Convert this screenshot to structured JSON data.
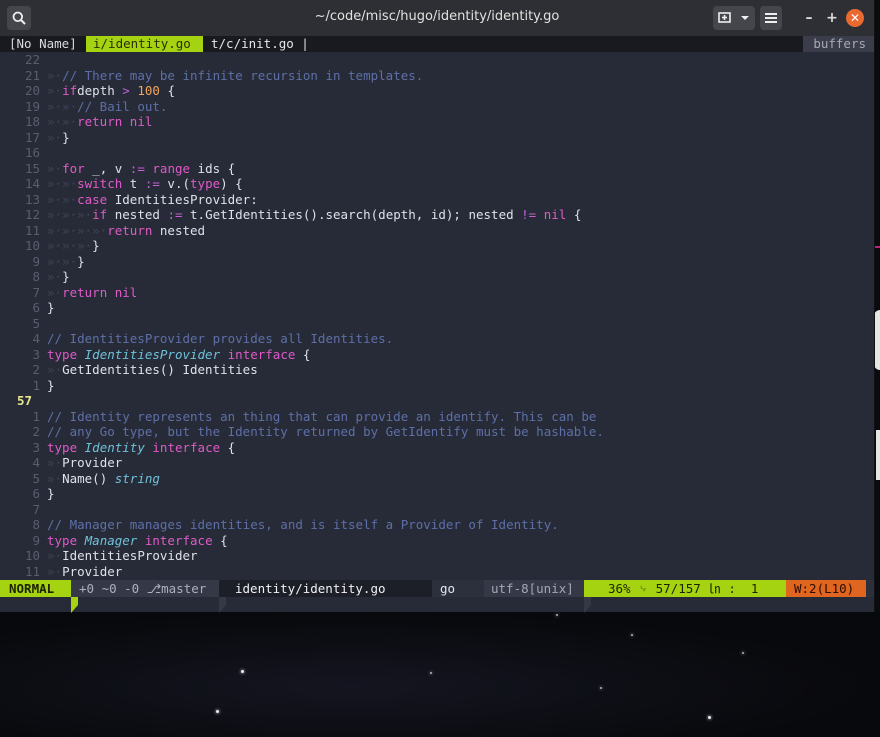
{
  "window": {
    "title": "~/code/misc/hugo/identity/identity.go"
  },
  "tabs": {
    "noname": "[No Name]",
    "active": "i/identity.go",
    "other": "t/c/init.go |",
    "buffers": "buffers"
  },
  "colors": {
    "accent": "#a5d312",
    "warning": "#e0651f",
    "close": "#e86a30",
    "background": "#272b38"
  },
  "icons": {
    "search": "search-icon",
    "newtab": "new-tab-icon",
    "dropdown": "chevron-down-icon",
    "menu": "hamburger-menu-icon",
    "minimize": "minimize-icon",
    "maximize": "maximize-icon",
    "close": "close-icon"
  },
  "editor": {
    "current_line": 57,
    "lines": [
      {
        "n": "22",
        "g": "",
        "segs": []
      },
      {
        "n": "21",
        "g": "»·",
        "segs": [
          [
            "cm",
            "// There may be infinite recursion in templates."
          ]
        ]
      },
      {
        "n": "20",
        "g": "»·",
        "segs": [
          [
            "kw",
            "if"
          ],
          [
            "",
            "depth "
          ],
          [
            "op",
            ">"
          ],
          [
            "",
            " "
          ],
          [
            "num",
            "100"
          ],
          [
            "",
            " {"
          ]
        ]
      },
      {
        "n": "19",
        "g": "»·»·",
        "segs": [
          [
            "cm",
            "// Bail out."
          ]
        ]
      },
      {
        "n": "18",
        "g": "»·»·",
        "segs": [
          [
            "kw",
            "return"
          ],
          [
            "",
            " "
          ],
          [
            "kw",
            "nil"
          ]
        ]
      },
      {
        "n": "17",
        "g": "»·",
        "segs": [
          [
            "",
            "}"
          ]
        ]
      },
      {
        "n": "16",
        "g": "",
        "segs": []
      },
      {
        "n": "15",
        "g": "»·",
        "segs": [
          [
            "kw",
            "for"
          ],
          [
            "",
            " _, v "
          ],
          [
            "op",
            ":="
          ],
          [
            "",
            " "
          ],
          [
            "kw",
            "range"
          ],
          [
            "",
            " ids {"
          ]
        ]
      },
      {
        "n": "14",
        "g": "»·»·",
        "segs": [
          [
            "kw",
            "switch"
          ],
          [
            "",
            " t "
          ],
          [
            "op",
            ":="
          ],
          [
            "",
            " v.("
          ],
          [
            "kw",
            "type"
          ],
          [
            "",
            ") {"
          ]
        ]
      },
      {
        "n": "13",
        "g": "»·»·",
        "segs": [
          [
            "kw",
            "case"
          ],
          [
            "",
            " IdentitiesProvider:"
          ]
        ]
      },
      {
        "n": "12",
        "g": "»·»·»·",
        "segs": [
          [
            "kw",
            "if"
          ],
          [
            "",
            " nested "
          ],
          [
            "op",
            ":="
          ],
          [
            "",
            " t.GetIdentities().search(depth, id); nested "
          ],
          [
            "op",
            "!="
          ],
          [
            "",
            " "
          ],
          [
            "kw",
            "nil"
          ],
          [
            "",
            " {"
          ]
        ]
      },
      {
        "n": "11",
        "g": "»·»·»·»·",
        "segs": [
          [
            "kw",
            "return"
          ],
          [
            "",
            " nested"
          ]
        ]
      },
      {
        "n": "10",
        "g": "»·»·»·",
        "segs": [
          [
            "",
            "}"
          ]
        ]
      },
      {
        "n": "9",
        "g": "»·»·",
        "segs": [
          [
            "",
            "}"
          ]
        ]
      },
      {
        "n": "8",
        "g": "»·",
        "segs": [
          [
            "",
            "}"
          ]
        ]
      },
      {
        "n": "7",
        "g": "»·",
        "segs": [
          [
            "kw",
            "return"
          ],
          [
            "",
            " "
          ],
          [
            "kw",
            "nil"
          ]
        ]
      },
      {
        "n": "6",
        "g": "",
        "segs": [
          [
            "",
            "}"
          ]
        ]
      },
      {
        "n": "5",
        "g": "",
        "segs": []
      },
      {
        "n": "4",
        "g": "",
        "segs": [
          [
            "cm",
            "// IdentitiesProvider provides all Identities."
          ]
        ]
      },
      {
        "n": "3",
        "g": "",
        "segs": [
          [
            "kw",
            "type"
          ],
          [
            "",
            " "
          ],
          [
            "ty",
            "IdentitiesProvider"
          ],
          [
            "",
            " "
          ],
          [
            "kw",
            "interface"
          ],
          [
            "",
            " {"
          ]
        ]
      },
      {
        "n": "2",
        "g": "»·",
        "segs": [
          [
            "",
            "GetIdentities() Identities"
          ]
        ]
      },
      {
        "n": "1",
        "g": "",
        "segs": [
          [
            "",
            "}"
          ]
        ]
      },
      {
        "n": "57",
        "g": "",
        "segs": [],
        "cur": true
      },
      {
        "n": "1",
        "g": "",
        "segs": [
          [
            "cm",
            "// Identity represents an thing that can provide an identify. This can be"
          ]
        ]
      },
      {
        "n": "2",
        "g": "",
        "segs": [
          [
            "cm",
            "// any Go type, but the Identity returned by GetIdentify must be hashable."
          ]
        ]
      },
      {
        "n": "3",
        "g": "",
        "segs": [
          [
            "kw",
            "type"
          ],
          [
            "",
            " "
          ],
          [
            "ty",
            "Identity"
          ],
          [
            "",
            " "
          ],
          [
            "kw",
            "interface"
          ],
          [
            "",
            " {"
          ]
        ]
      },
      {
        "n": "4",
        "g": "»·",
        "segs": [
          [
            "",
            "Provider"
          ]
        ]
      },
      {
        "n": "5",
        "g": "»·",
        "segs": [
          [
            "",
            "Name() "
          ],
          [
            "ty",
            "string"
          ]
        ]
      },
      {
        "n": "6",
        "g": "",
        "segs": [
          [
            "",
            "}"
          ]
        ]
      },
      {
        "n": "7",
        "g": "",
        "segs": []
      },
      {
        "n": "8",
        "g": "",
        "segs": [
          [
            "cm",
            "// Manager manages identities, and is itself a Provider of Identity."
          ]
        ]
      },
      {
        "n": "9",
        "g": "",
        "segs": [
          [
            "kw",
            "type"
          ],
          [
            "",
            " "
          ],
          [
            "ty",
            "Manager"
          ],
          [
            "",
            " "
          ],
          [
            "kw",
            "interface"
          ],
          [
            "",
            " {"
          ]
        ]
      },
      {
        "n": "10",
        "g": "»·",
        "segs": [
          [
            "",
            "IdentitiesProvider"
          ]
        ]
      },
      {
        "n": "11",
        "g": "»·",
        "segs": [
          [
            "",
            "Provider"
          ]
        ]
      }
    ]
  },
  "statusline": {
    "mode": "NORMAL",
    "git": "+0 ~0 -0 ⎇master",
    "file": "identity/identity.go",
    "filetype": "go",
    "encoding": "utf-8[unix]",
    "position": "36% ␊ 57/157 ㏑ :  1",
    "warning": "W:2(L10)"
  }
}
